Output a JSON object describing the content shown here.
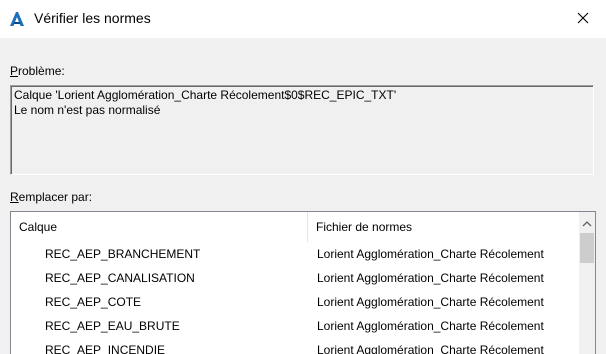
{
  "window": {
    "title": "Vérifier les normes"
  },
  "problem": {
    "label_first": "P",
    "label_rest": "roblème:",
    "lines": [
      "Calque 'Lorient Agglomération_Charte Récolement$0$REC_EPIC_TXT'",
      "Le nom n'est pas normalisé"
    ]
  },
  "replace": {
    "label_first": "R",
    "label_rest": "emplacer par:"
  },
  "list": {
    "columns": [
      "Calque",
      "Fichier de normes"
    ],
    "rows": [
      [
        "REC_AEP_BRANCHEMENT",
        "Lorient Agglomération_Charte Récolement"
      ],
      [
        "REC_AEP_CANALISATION",
        "Lorient Agglomération_Charte Récolement"
      ],
      [
        "REC_AEP_COTE",
        "Lorient Agglomération_Charte Récolement"
      ],
      [
        "REC_AEP_EAU_BRUTE",
        "Lorient Agglomération_Charte Récolement"
      ],
      [
        "REC_AEP_INCENDIE",
        "Lorient Agglomération_Charte Récolement"
      ]
    ]
  },
  "colors": {
    "app_icon": "#1c6fb8",
    "background": "#f0f0f0"
  },
  "icons": {
    "app": "autocad-a-icon",
    "close": "close-icon",
    "scroll_up": "chevron-up-icon"
  }
}
